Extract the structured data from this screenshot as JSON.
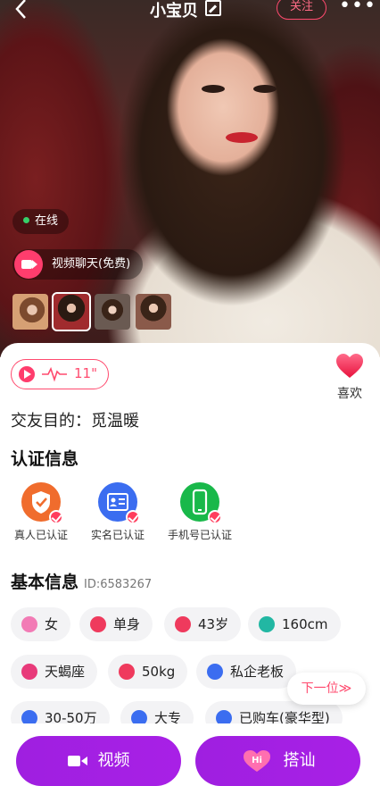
{
  "header": {
    "back_icon": "chevron-left-icon",
    "nickname": "小宝贝",
    "follow_label": "关注",
    "more_label": "•••"
  },
  "profile": {
    "online_label": "在线",
    "video_chat_label": "视频聊天(免费)",
    "voice_duration": "11\"",
    "like_label": "喜欢",
    "purpose_label": "交友目的：觅温暖"
  },
  "sections": {
    "cert_title": "认证信息",
    "basic_title": "基本信息",
    "basic_id": "ID:6583267"
  },
  "certifications": [
    {
      "label": "真人已认证",
      "color": "#f06c2d",
      "icon": "badge-icon"
    },
    {
      "label": "实名已认证",
      "color": "#3b6df0",
      "icon": "id-card-icon"
    },
    {
      "label": "手机号已认证",
      "color": "#19b84a",
      "icon": "phone-icon"
    }
  ],
  "basic_tags": [
    {
      "label": "女",
      "color": "#f27bb5",
      "icon": "female-icon"
    },
    {
      "label": "单身",
      "color": "#ef3a5d",
      "icon": "heart-icon"
    },
    {
      "label": "43岁",
      "color": "#ef3a5d",
      "icon": "cake-icon"
    },
    {
      "label": "160cm",
      "color": "#22b7a3",
      "icon": "ruler-icon"
    },
    {
      "label": "天蝎座",
      "color": "#e83a7a",
      "icon": "zodiac-icon"
    },
    {
      "label": "50kg",
      "color": "#ef3a5d",
      "icon": "scale-icon"
    },
    {
      "label": "私企老板",
      "color": "#3b6df0",
      "icon": "tie-icon"
    },
    {
      "label": "30-50万",
      "color": "#3b6df0",
      "icon": "wallet-icon"
    },
    {
      "label": "大专",
      "color": "#3b6df0",
      "icon": "graduation-cap-icon"
    },
    {
      "label": "已购车(豪华型)",
      "color": "#3b6df0",
      "icon": "car-icon"
    }
  ],
  "next_label": "下一位≫",
  "actions": {
    "video_label": "视频",
    "chat_label": "搭讪",
    "chat_badge": "Hi"
  },
  "colors": {
    "accent": "#ff4a6e",
    "button_purple": "#a020e4"
  }
}
